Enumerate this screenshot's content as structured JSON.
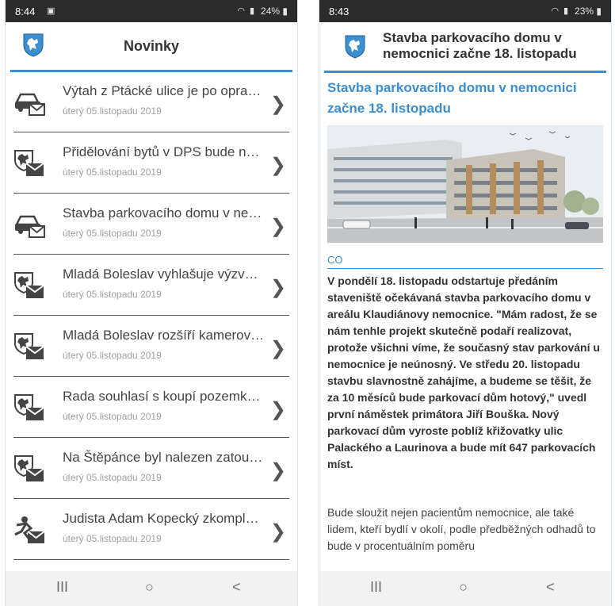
{
  "left": {
    "statusbar": {
      "time": "8:44",
      "battery": "24%"
    },
    "header": {
      "title": "Novinky"
    },
    "news": [
      {
        "title": "Výtah z Ptácké ulice je po oprav…",
        "date": "úterý 05.listopadu 2019",
        "icon": "car-mail-icon"
      },
      {
        "title": "Přidělování bytů v DPS bude nyn…",
        "date": "úterý 05.listopadu 2019",
        "icon": "coat-of-arms-mail-icon"
      },
      {
        "title": "Stavba parkovacího domu v ne…",
        "date": "úterý 05.listopadu 2019",
        "icon": "car-mail-icon"
      },
      {
        "title": "Mladá Boleslav vyhlašuje výzvu…",
        "date": "úterý 05.listopadu 2019",
        "icon": "coat-of-arms-mail-icon"
      },
      {
        "title": "Mladá Boleslav rozšíří kamerový…",
        "date": "úterý 05.listopadu 2019",
        "icon": "coat-of-arms-mail-icon"
      },
      {
        "title": "Rada souhlasí s koupí pozemku…",
        "date": "úterý 05.listopadu 2019",
        "icon": "coat-of-arms-mail-icon"
      },
      {
        "title": "Na Štěpánce byl nalezen zatoul…",
        "date": "úterý 05.listopadu 2019",
        "icon": "coat-of-arms-mail-icon"
      },
      {
        "title": "Judista Adam Kopecký zkomple…",
        "date": "úterý 05.listopadu 2019",
        "icon": "sport-mail-icon"
      }
    ]
  },
  "right": {
    "statusbar": {
      "time": "8:43",
      "battery": "23%"
    },
    "header": {
      "title": "Stavba parkovacího domu v nemocnici začne 18. listopadu"
    },
    "article": {
      "title": "Stavba parkovacího domu v nemocnici začne 18. listopadu",
      "section": "CO",
      "bold_text": "V pondělí 18. listopadu odstartuje předáním staveniště očekávaná stavba parkovacího domu v areálu Klaudiánovy nemocnice. \"Mám radost, že se nám tenhle projekt skutečně podaří realizovat, protože všichni víme, že současný stav parkování u nemocnice je neúnosný. Ve středu 20. listopadu stavbu slavnostně zahájíme, a budeme se těšit, že za 10 měsíců bude parkovací dům hotový,\" uvedl první náměstek primátora Jiří Bouška. Nový parkovací dům vyroste poblíž křižovatky ulic Palackého a Laurinova a bude mít 647 parkovacích míst.",
      "text": "Bude sloužit nejen pacientům nemocnice, ale také lidem, kteří bydlí v okolí, podle předběžných odhadů to bude v procentuálním poměru"
    }
  },
  "navbar": {
    "recents": "III",
    "home": "○",
    "back": "<"
  },
  "colors": {
    "accent": "#3b8ed0",
    "statusbar": "#2b2b2b",
    "navbar": "#f2f2f2"
  }
}
